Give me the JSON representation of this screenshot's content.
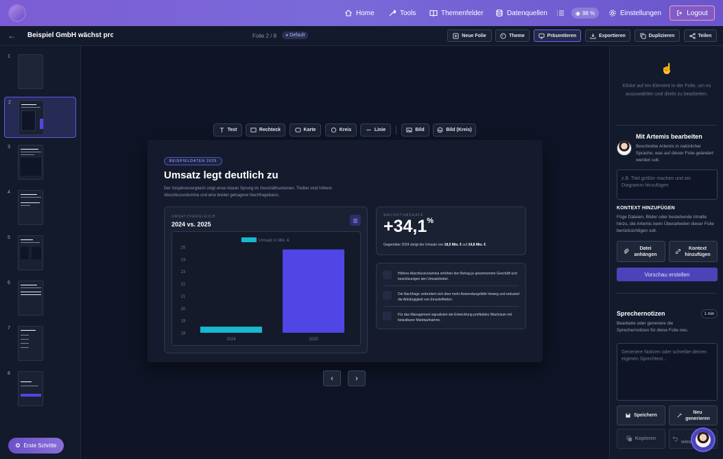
{
  "nav": {
    "home": "Home",
    "tools": "Tools",
    "themenfelder": "Themenfelder",
    "datenquellen": "Datenquellen",
    "zoom": "98 %",
    "einstellungen": "Einstellungen",
    "logout": "Logout"
  },
  "editor": {
    "title": "Beispiel GmbH wächst profi",
    "slide_counter": "Folie 2 / 8",
    "theme_badge": "Default",
    "actions": [
      "Neue Folie",
      "Theme",
      "Präsentieren",
      "Exportieren",
      "Duplizieren",
      "Teilen"
    ]
  },
  "thumbnails": [
    "1",
    "2",
    "3",
    "4",
    "5",
    "6",
    "7",
    "8"
  ],
  "first_steps": "Erste Schritte",
  "tools": [
    "Text",
    "Rechteck",
    "Karte",
    "Kreis",
    "Linie",
    "Bild",
    "Bild (Kreis)"
  ],
  "slide": {
    "badge": "BEISPIELDATEN 2025",
    "title": "Umsatz legt deutlich zu",
    "subtitle": "Der Vorjahresvergleich zeigt einen klaren Sprung im Geschäftsvolumen. Treiber sind höhere Abschlussvolumina und eine breiter getragene Nachfragebasis.",
    "chart_card": {
      "label": "UMSATZVERGLEICH",
      "title": "2024 vs. 2025"
    },
    "kpi": {
      "label": "WACHSTUMSRATE",
      "value": "+34,1",
      "unit": "%",
      "text_before": "Gegenüber 2024 steigt der Umsatz von ",
      "from": "18,5 Mio. €",
      "text_mid": " auf ",
      "to": "24,8 Mio. €",
      "text_end": "."
    },
    "bullets": [
      "Höhere Abschlussvolumina erhöhen den Betrag je gewonnenem Geschäft und beschleunigen den Umsatzhebel.",
      "Die Nachfrage verbreitert sich über mehr Anwendungsfälle hinweg und reduziert die Abhängigkeit von Einzeleffekten.",
      "Für das Management signalisiert die Entwicklung profitables Wachstum mit belastbarer Marktaufnahme."
    ]
  },
  "chart_data": {
    "type": "bar",
    "categories": [
      "2024",
      "2025"
    ],
    "series": [
      {
        "name": "Umsatz in Mio. €",
        "values": [
          18.5,
          24.8
        ]
      }
    ],
    "ylim": [
      18,
      25
    ],
    "yticks": [
      "18",
      "19",
      "20",
      "21",
      "22",
      "23",
      "24",
      "25"
    ],
    "colors": [
      "#17b8d0",
      "#5046e5"
    ],
    "legend": "top"
  },
  "right_panel": {
    "hint": "Klicke auf ein Element in der Folie, um es auszuwählen und direkt zu bearbeiten.",
    "artemis_title": "Mit Artemis bearbeiten",
    "artemis_desc": "Beschreibe Artemis in natürlicher Sprache, was auf dieser Folie geändert werden soll.",
    "artemis_placeholder": "z.B. Titel größer machen und ein Diagramm hinzufügen",
    "context_title": "KONTEXT HINZUFÜGEN",
    "context_desc": "Füge Dateien, Bilder oder bestehende Inhalte hinzu, die Artemis beim Überarbeiten dieser Folie berücksichtigen soll.",
    "attach_file": "Datei anhängen",
    "add_context": "Kontext hinzufügen",
    "preview": "Vorschau erstellen",
    "notes_title": "Sprechernotizen",
    "notes_badge": "1 min",
    "notes_desc": "Bearbeite oder generiere die Sprechernotizen für diese Folie neu.",
    "notes_placeholder": "Generiere Notizen oder schreibe deinen eigenen Sprechtext...",
    "save": "Speichern",
    "regenerate": "Neu generieren",
    "copy": "Kopieren",
    "restore": "wiederherst."
  }
}
